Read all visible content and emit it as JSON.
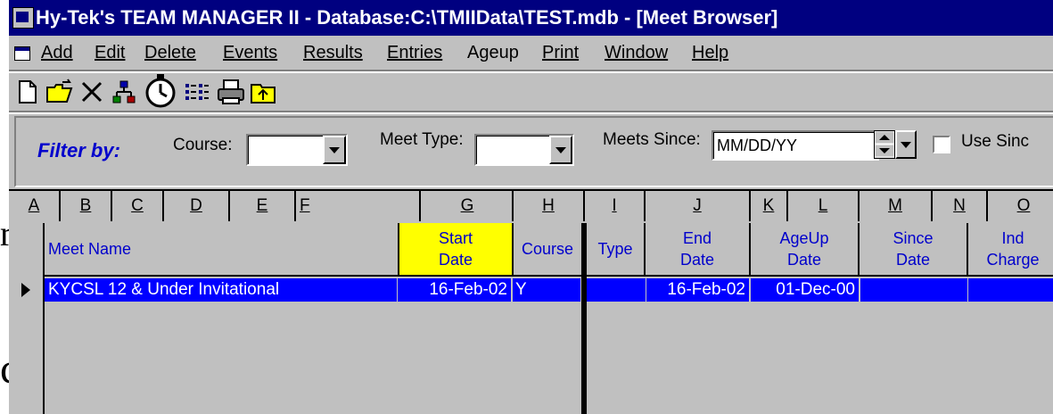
{
  "window": {
    "title": "Hy-Tek's TEAM MANAGER II - Database:C:\\TMIIData\\TEST.mdb - [Meet Browser]"
  },
  "menu": {
    "items": [
      "Add",
      "Edit",
      "Delete",
      "Events",
      "Results",
      "Entries",
      "Ageup",
      "Print",
      "Window",
      "Help"
    ]
  },
  "toolbar": {
    "icons": [
      "new-icon",
      "open-folder-icon",
      "delete-x-icon",
      "relay-tree-icon",
      "stopwatch-icon",
      "list-icon",
      "printer-icon",
      "export-icon"
    ]
  },
  "filter": {
    "label": "Filter by:",
    "course_label": "Course:",
    "course_value": "",
    "meet_type_label": "Meet Type:",
    "meet_type_value": "",
    "meets_since_label": "Meets Since:",
    "meets_since_value": "MM/DD/YY",
    "use_since_label": "Use Sinc",
    "use_since_checked": false
  },
  "columns": {
    "letters": [
      "A",
      "B",
      "C",
      "D",
      "E",
      "F",
      "G",
      "H",
      "I",
      "J",
      "K",
      "L",
      "M",
      "N",
      "O"
    ]
  },
  "grid": {
    "headers": {
      "meet_name": "Meet Name",
      "start_date_1": "Start",
      "start_date_2": "Date",
      "course": "Course",
      "type": "Type",
      "end_date_1": "End",
      "end_date_2": "Date",
      "ageup_1": "AgeUp",
      "ageup_2": "Date",
      "since_1": "Since",
      "since_2": "Date",
      "ind_1": "Ind",
      "ind_2": "Charge"
    },
    "rows": [
      {
        "meet_name": "KYCSL  12 & Under Invitational",
        "start_date": "16-Feb-02",
        "course": "Y",
        "type": "",
        "end_date": "16-Feb-02",
        "ageup_date": "01-Dec-00",
        "since_date": "",
        "ind_charge": ""
      }
    ]
  },
  "background_text": {
    "left_char_1": "r",
    "left_char_2": "c"
  },
  "colors": {
    "title_bar": "#000080",
    "selection": "#0000ff",
    "header_text": "#0000cc",
    "highlight_header": "#ffff00",
    "face": "#c0c0c0"
  }
}
